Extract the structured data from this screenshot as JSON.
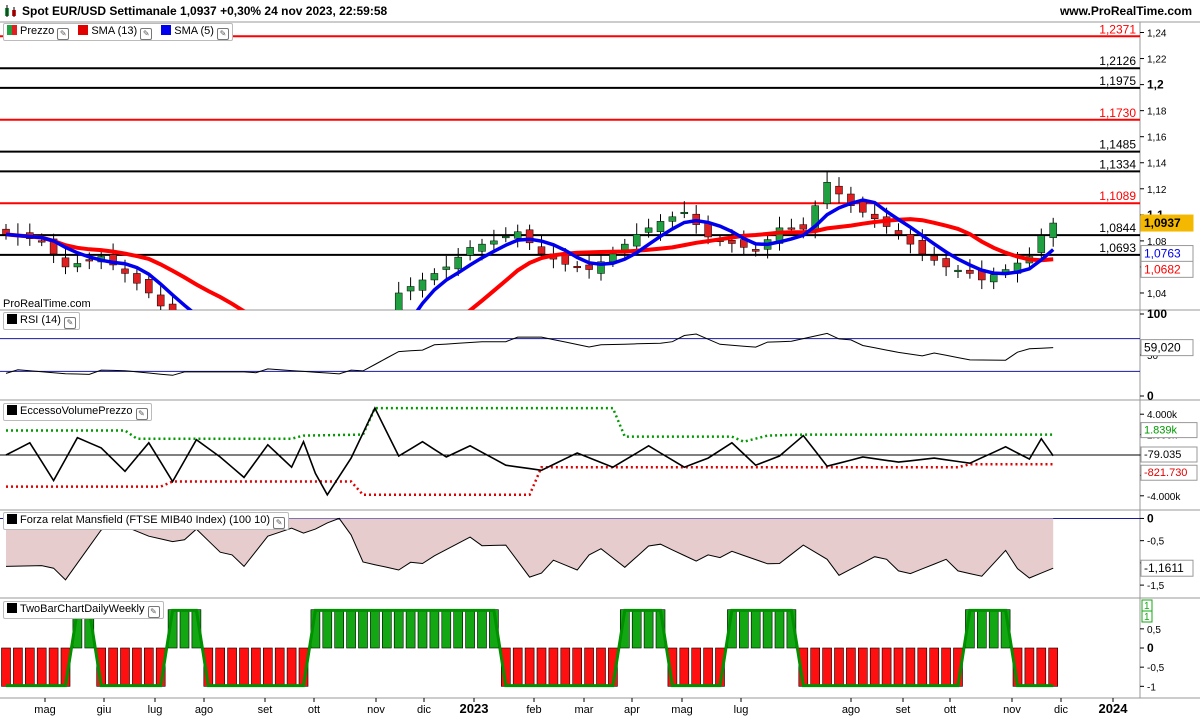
{
  "header": {
    "title": "Spot EUR/USD Settimanale 1,0937 +0,30% 24 nov 2023, 22:59:58",
    "site": "www.ProRealTime.com",
    "watermark": "ProRealTime.com"
  },
  "legend": {
    "prezzo": "Prezzo",
    "sma13": "SMA (13)",
    "sma5": "SMA (5)"
  },
  "colors": {
    "up": "#20a040",
    "down": "#e02020",
    "sma13": "#ff0000",
    "sma5": "#0000ee",
    "green_dots": "#009a00"
  },
  "chart_data": [
    {
      "type": "candlestick",
      "name": "price",
      "ylim": [
        1.03,
        1.245
      ],
      "ticks": [
        "1,24",
        "1,22",
        "1,2",
        "1,18",
        "1,16",
        "1,14",
        "1,12",
        "1,1",
        "1,08",
        "1,06",
        "1,04"
      ],
      "tick_values": [
        1.24,
        1.22,
        1.2,
        1.18,
        1.16,
        1.14,
        1.12,
        1.1,
        1.08,
        1.06,
        1.04
      ],
      "hlines": [
        {
          "value": 1.2371,
          "label": "1,2371",
          "color": "#ff0000"
        },
        {
          "value": 1.2126,
          "label": "1,2126",
          "color": "#000000"
        },
        {
          "value": 1.1975,
          "label": "1,1975",
          "color": "#000000"
        },
        {
          "value": 1.173,
          "label": "1,1730",
          "color": "#ff0000"
        },
        {
          "value": 1.1485,
          "label": "1,1485",
          "color": "#000000"
        },
        {
          "value": 1.1334,
          "label": "1,1334",
          "color": "#000000"
        },
        {
          "value": 1.1089,
          "label": "1,1089",
          "color": "#ff0000"
        },
        {
          "value": 1.0844,
          "label": "1,0844",
          "color": "#000000"
        },
        {
          "value": 1.0693,
          "label": "1,0693",
          "color": "#000000"
        }
      ],
      "last_price": {
        "label": "1,0937"
      },
      "sma5_last": {
        "label": "1,0763"
      },
      "sma13_last": {
        "label": "1,0682"
      },
      "anchors": [
        [
          0,
          1.085
        ],
        [
          3,
          1.08
        ],
        [
          5,
          1.06
        ],
        [
          8,
          1.068
        ],
        [
          10,
          1.055
        ],
        [
          12,
          1.04
        ],
        [
          14,
          1.02
        ],
        [
          16,
          1.01
        ],
        [
          18,
          1.0
        ],
        [
          20,
          0.99
        ],
        [
          22,
          0.995
        ],
        [
          24,
          0.975
        ],
        [
          26,
          0.985
        ],
        [
          28,
          0.98
        ],
        [
          30,
          0.985
        ],
        [
          33,
          1.04
        ],
        [
          35,
          1.05
        ],
        [
          37,
          1.06
        ],
        [
          39,
          1.075
        ],
        [
          41,
          1.08
        ],
        [
          43,
          1.087
        ],
        [
          45,
          1.07
        ],
        [
          47,
          1.062
        ],
        [
          49,
          1.058
        ],
        [
          51,
          1.07
        ],
        [
          53,
          1.085
        ],
        [
          55,
          1.095
        ],
        [
          57,
          1.102
        ],
        [
          59,
          1.083
        ],
        [
          61,
          1.078
        ],
        [
          63,
          1.072
        ],
        [
          65,
          1.09
        ],
        [
          67,
          1.089
        ],
        [
          69,
          1.125
        ],
        [
          71,
          1.107
        ],
        [
          73,
          1.097
        ],
        [
          75,
          1.085
        ],
        [
          77,
          1.07
        ],
        [
          79,
          1.06
        ],
        [
          81,
          1.055
        ],
        [
          82,
          1.05
        ],
        [
          84,
          1.058
        ],
        [
          86,
          1.068
        ],
        [
          87,
          1.084
        ],
        [
          88,
          1.0937
        ]
      ]
    },
    {
      "type": "line",
      "name": "rsi",
      "ylim": [
        0,
        100
      ],
      "ticks": [
        "100",
        "50",
        "0"
      ],
      "tick_values": [
        100,
        50,
        0
      ],
      "bands": [
        30,
        70
      ],
      "legend": "RSI (14)",
      "last_label": "59,020",
      "anchors": [
        [
          0,
          30
        ],
        [
          5,
          28
        ],
        [
          10,
          30
        ],
        [
          15,
          27
        ],
        [
          20,
          31
        ],
        [
          25,
          30
        ],
        [
          30,
          29
        ],
        [
          33,
          55
        ],
        [
          36,
          60
        ],
        [
          40,
          67
        ],
        [
          45,
          71
        ],
        [
          50,
          60
        ],
        [
          55,
          66
        ],
        [
          58,
          74
        ],
        [
          60,
          63
        ],
        [
          63,
          62
        ],
        [
          66,
          66
        ],
        [
          69,
          78
        ],
        [
          72,
          60
        ],
        [
          75,
          54
        ],
        [
          78,
          50
        ],
        [
          81,
          44
        ],
        [
          84,
          46
        ],
        [
          86,
          56
        ],
        [
          88,
          59
        ]
      ]
    },
    {
      "type": "line",
      "name": "eccesso_volume",
      "ylim": [
        -5000,
        5000
      ],
      "ticks": [
        "4.000k",
        "2.000k",
        "0",
        "-2.000k",
        "-4.000k"
      ],
      "tick_values": [
        4000,
        2000,
        0,
        -2000,
        -4000
      ],
      "legend": "EccessoVolumePrezzo",
      "last_labels": [
        "1.839k",
        "-79.035",
        "-821.730"
      ],
      "upper_dotted": [
        [
          0,
          2400
        ],
        [
          10,
          2400
        ],
        [
          11,
          1600
        ],
        [
          24,
          1600
        ],
        [
          25,
          1900
        ],
        [
          30,
          2000
        ],
        [
          31,
          4600
        ],
        [
          51,
          4600
        ],
        [
          52,
          1800
        ],
        [
          61,
          1800
        ],
        [
          62,
          1300
        ],
        [
          64,
          1900
        ],
        [
          67,
          2000
        ],
        [
          88,
          2000
        ]
      ],
      "lower_dotted": [
        [
          0,
          -3100
        ],
        [
          13,
          -3100
        ],
        [
          14,
          -2600
        ],
        [
          29,
          -2600
        ],
        [
          30,
          -3900
        ],
        [
          44,
          -3900
        ],
        [
          45,
          -1200
        ],
        [
          80,
          -1200
        ],
        [
          81,
          -900
        ],
        [
          88,
          -900
        ]
      ],
      "anchors": [
        [
          0,
          0
        ],
        [
          2,
          1200
        ],
        [
          4,
          -2500
        ],
        [
          6,
          1700
        ],
        [
          8,
          700
        ],
        [
          10,
          -1600
        ],
        [
          12,
          1200
        ],
        [
          14,
          -2600
        ],
        [
          16,
          1500
        ],
        [
          18,
          -200
        ],
        [
          20,
          -2200
        ],
        [
          22,
          1000
        ],
        [
          24,
          -1200
        ],
        [
          25,
          1300
        ],
        [
          26,
          -1800
        ],
        [
          27,
          -3900
        ],
        [
          29,
          -300
        ],
        [
          31,
          4600
        ],
        [
          33,
          -100
        ],
        [
          35,
          1300
        ],
        [
          37,
          -200
        ],
        [
          39,
          900
        ],
        [
          42,
          -1000
        ],
        [
          45,
          -1500
        ],
        [
          48,
          200
        ],
        [
          51,
          -1200
        ],
        [
          54,
          900
        ],
        [
          57,
          -1200
        ],
        [
          59,
          -300
        ],
        [
          61,
          1200
        ],
        [
          63,
          -1000
        ],
        [
          65,
          -100
        ],
        [
          67,
          1900
        ],
        [
          69,
          -1100
        ],
        [
          72,
          -200
        ],
        [
          75,
          -700
        ],
        [
          78,
          -300
        ],
        [
          81,
          -800
        ],
        [
          84,
          800
        ],
        [
          86,
          -400
        ],
        [
          87,
          1600
        ],
        [
          88,
          -79
        ]
      ]
    },
    {
      "type": "area",
      "name": "forza_relativa",
      "ylim": [
        -1.7,
        0.1
      ],
      "ticks": [
        "0",
        "-0,5",
        "-1",
        "-1,5"
      ],
      "tick_values": [
        0,
        -0.5,
        -1,
        -1.5
      ],
      "legend": "Forza relat Mansfield (FTSE MIB40 Index) (100 10)",
      "last_label": "-1,1611",
      "anchors": [
        [
          0,
          -1.0
        ],
        [
          3,
          -1.1
        ],
        [
          5,
          -1.3
        ],
        [
          8,
          -0.3
        ],
        [
          10,
          -0.1
        ],
        [
          12,
          -0.4
        ],
        [
          14,
          -0.6
        ],
        [
          16,
          -0.2
        ],
        [
          18,
          -0.8
        ],
        [
          20,
          -1.0
        ],
        [
          22,
          -0.4
        ],
        [
          24,
          -0.3
        ],
        [
          26,
          -0.2
        ],
        [
          28,
          0.0
        ],
        [
          30,
          -0.9
        ],
        [
          33,
          -1.2
        ],
        [
          36,
          -0.8
        ],
        [
          39,
          -0.5
        ],
        [
          42,
          -0.6
        ],
        [
          44,
          -1.4
        ],
        [
          46,
          -0.9
        ],
        [
          48,
          -1.2
        ],
        [
          50,
          -0.6
        ],
        [
          52,
          -1.1
        ],
        [
          55,
          -0.5
        ],
        [
          58,
          -1.0
        ],
        [
          61,
          -0.7
        ],
        [
          64,
          -1.1
        ],
        [
          67,
          -0.6
        ],
        [
          70,
          -1.2
        ],
        [
          73,
          -0.9
        ],
        [
          76,
          -1.2
        ],
        [
          79,
          -1.0
        ],
        [
          82,
          -1.3
        ],
        [
          84,
          -0.8
        ],
        [
          86,
          -1.3
        ],
        [
          88,
          -1.16
        ]
      ]
    },
    {
      "type": "bar",
      "name": "two_bar",
      "ylim": [
        -1.2,
        1.2
      ],
      "ticks": [
        "0,5",
        "0",
        "-0,5",
        "-1"
      ],
      "tick_values": [
        0.5,
        0,
        -0.5,
        -1
      ],
      "legend": "TwoBarChartDailyWeekly",
      "last_labels": [
        "1",
        "1"
      ],
      "segments": [
        [
          0,
          6,
          -1
        ],
        [
          6,
          8,
          1
        ],
        [
          8,
          14,
          -1
        ],
        [
          14,
          17,
          1
        ],
        [
          17,
          26,
          -1
        ],
        [
          26,
          42,
          1
        ],
        [
          42,
          52,
          -1
        ],
        [
          52,
          56,
          1
        ],
        [
          56,
          61,
          -1
        ],
        [
          61,
          67,
          1
        ],
        [
          67,
          81,
          -1
        ],
        [
          81,
          85,
          1
        ]
      ]
    }
  ],
  "x_axis": {
    "labels": [
      "mag",
      "giu",
      "lug",
      "ago",
      "set",
      "ott",
      "nov",
      "dic",
      "2023",
      "feb",
      "mar",
      "apr",
      "mag",
      "lug",
      "ago",
      "set",
      "ott",
      "nov",
      "dic",
      "2024"
    ],
    "bold": [
      "2023",
      "2024"
    ]
  }
}
